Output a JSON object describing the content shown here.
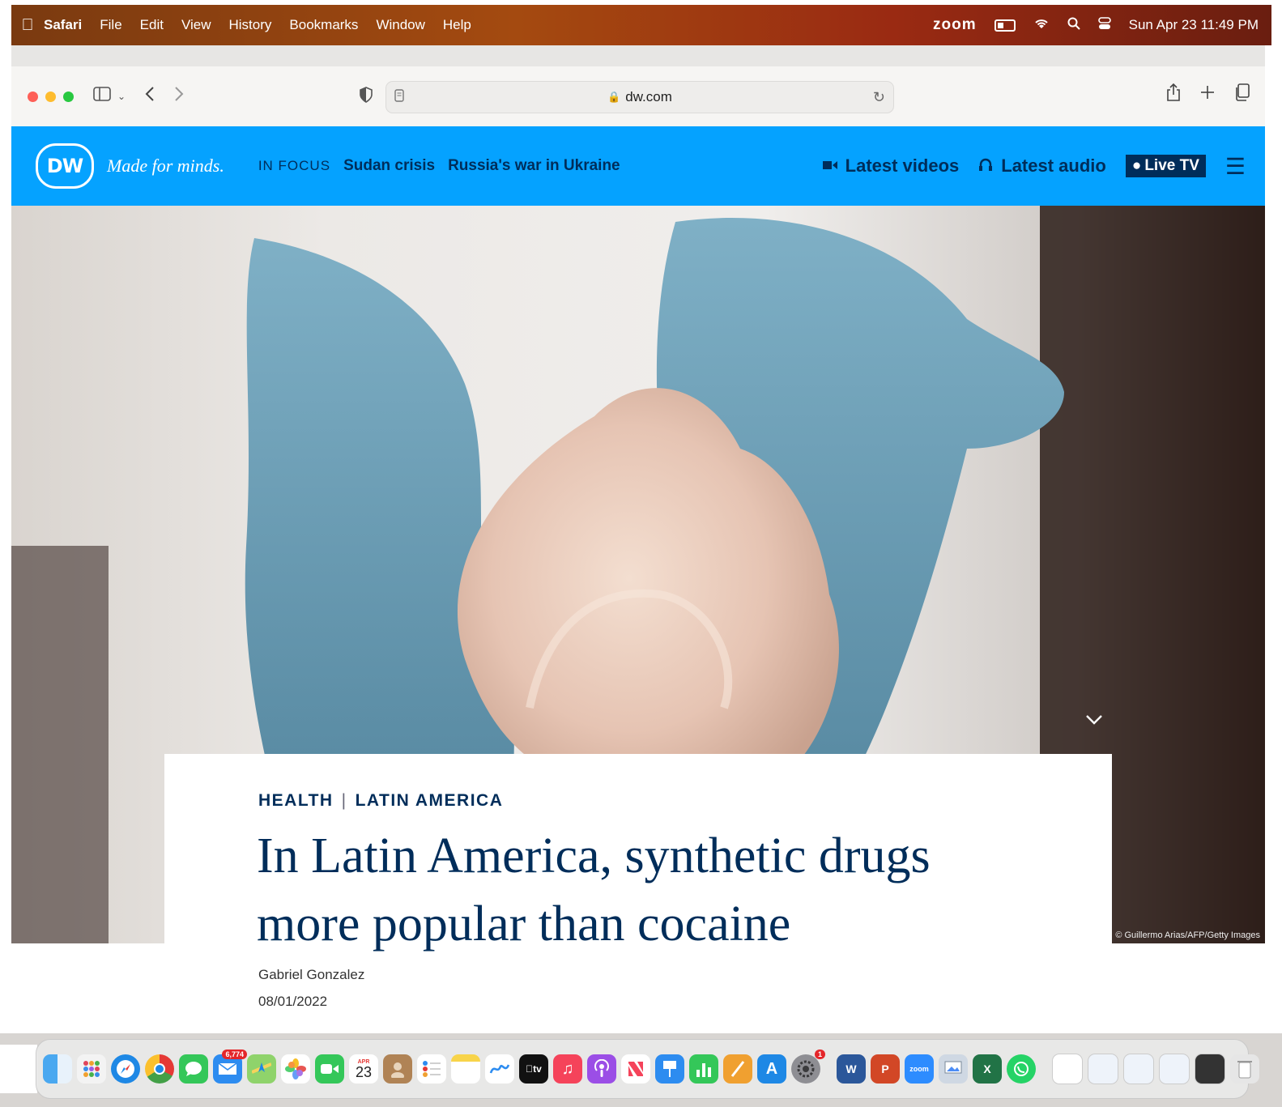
{
  "menubar": {
    "app_name": "Safari",
    "items": [
      "File",
      "Edit",
      "View",
      "History",
      "Bookmarks",
      "Window",
      "Help"
    ],
    "zoom_label": "zoom",
    "datetime": "Sun Apr 23  11:49 PM"
  },
  "browser": {
    "url": "dw.com"
  },
  "site": {
    "tagline": "Made for minds.",
    "logo_text": "DW",
    "in_focus_label": "IN FOCUS",
    "focus_links": [
      "Sudan crisis",
      "Russia's war in Ukraine"
    ],
    "latest_videos": "Latest videos",
    "latest_audio": "Latest audio",
    "live_tv": "Live TV",
    "brand_color": "#05a2ff",
    "text_color": "#002d5a"
  },
  "article": {
    "image_credit": "© Guillermo Arias/AFP/Getty Images",
    "category_1": "HEALTH",
    "category_sep": "|",
    "category_2": "LATIN AMERICA",
    "headline": "In Latin America, synthetic drugs more popular than cocaine",
    "author": "Gabriel Gonzalez",
    "date": "08/01/2022"
  },
  "dock": {
    "mail_badge": "6,774",
    "calendar_month": "APR",
    "calendar_day": "23",
    "settings_badge": "1",
    "apps": [
      "Finder",
      "Launchpad",
      "Safari",
      "Chrome",
      "Messages",
      "Mail",
      "Maps",
      "Photos",
      "FaceTime",
      "Calendar",
      "Contacts",
      "Reminders",
      "Notes",
      "Freeform",
      "TV",
      "Music",
      "Podcasts",
      "News",
      "Keynote",
      "Numbers",
      "Pages",
      "App Store",
      "System Settings",
      "Word",
      "PowerPoint",
      "Zoom",
      "Preview",
      "Excel",
      "WhatsApp",
      "Trash"
    ]
  }
}
